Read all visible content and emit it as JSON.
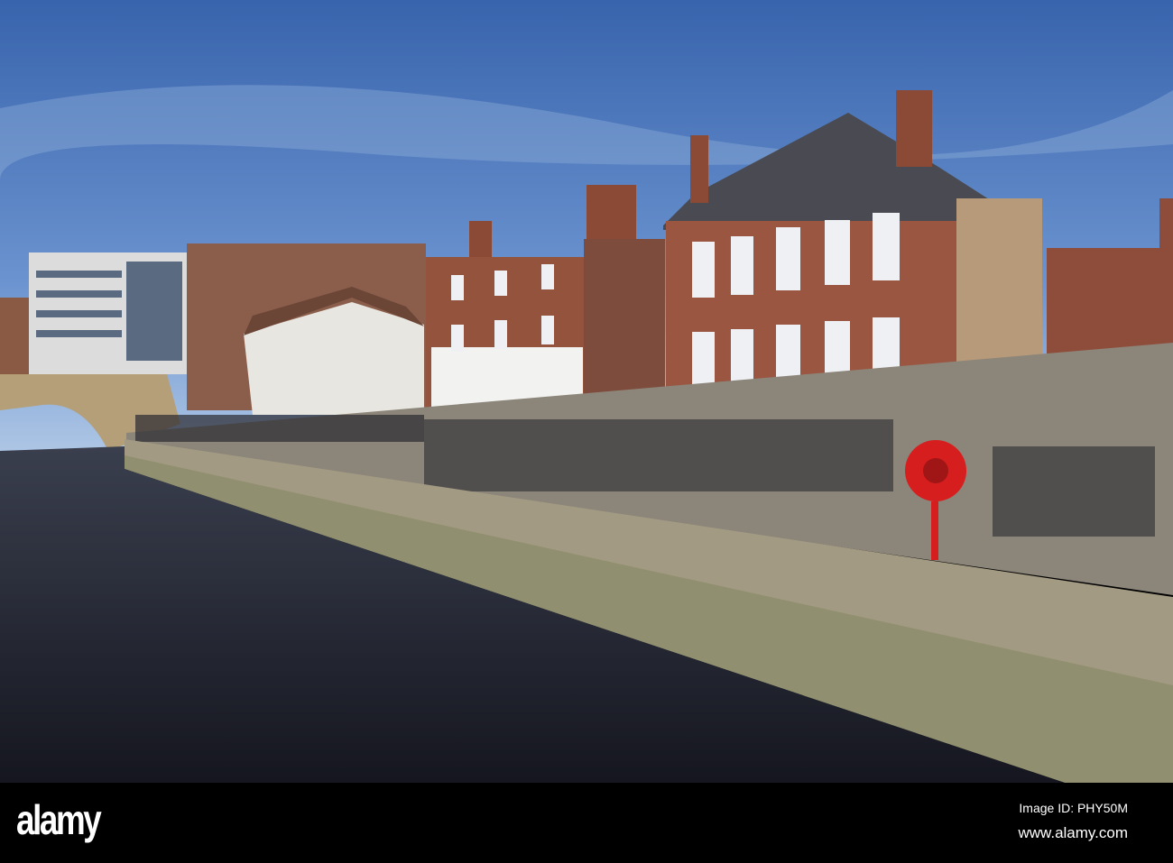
{
  "watermark": {
    "logo": "alamy",
    "image_id": "Image ID: PHY50M",
    "url": "www.alamy.com"
  }
}
